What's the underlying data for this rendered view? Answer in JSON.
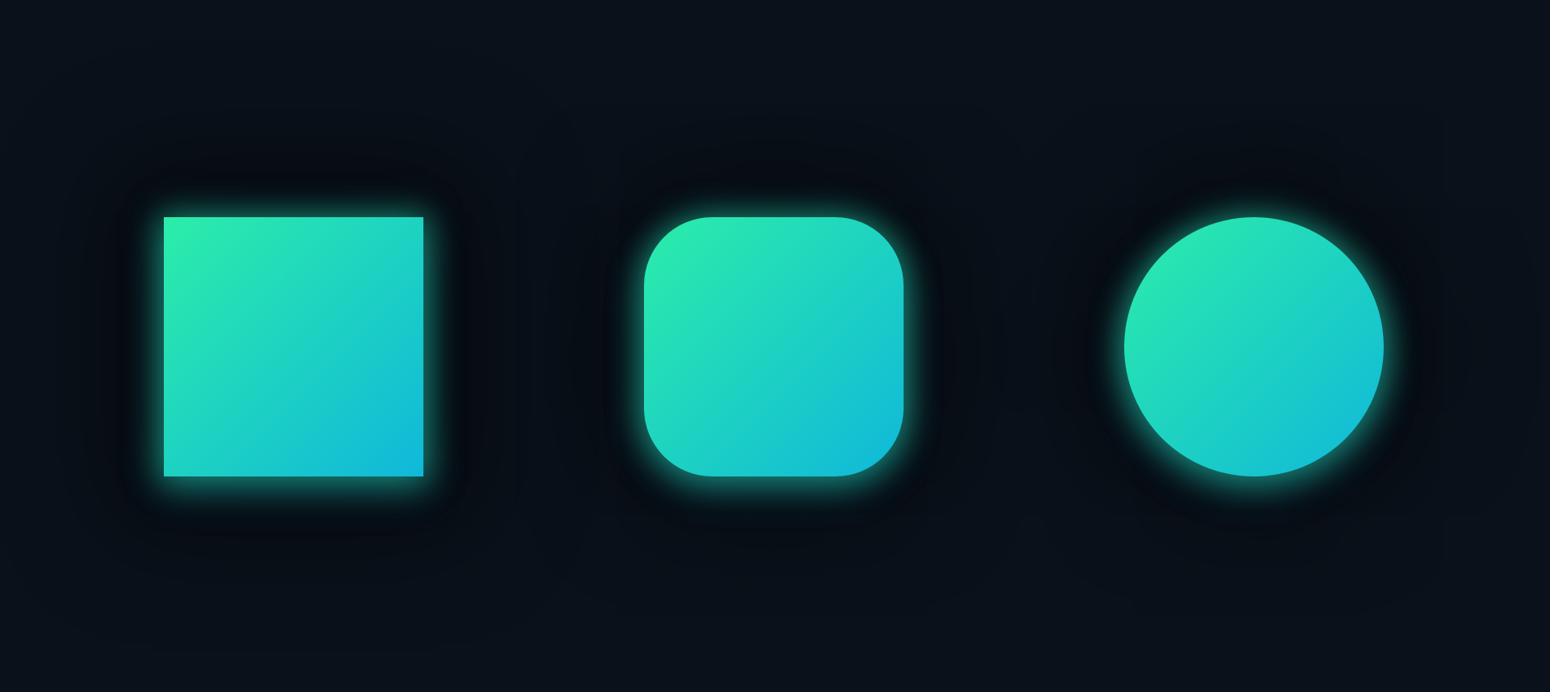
{
  "colors": {
    "background": "#0a111a",
    "gradient_start": "#2ceda9",
    "gradient_end": "#10b8da",
    "glow": "#22c8a0"
  },
  "shapes": [
    {
      "name": "square",
      "style": "sharp corners"
    },
    {
      "name": "rounded-square",
      "style": "rounded corners"
    },
    {
      "name": "circle",
      "style": "fully round"
    }
  ]
}
